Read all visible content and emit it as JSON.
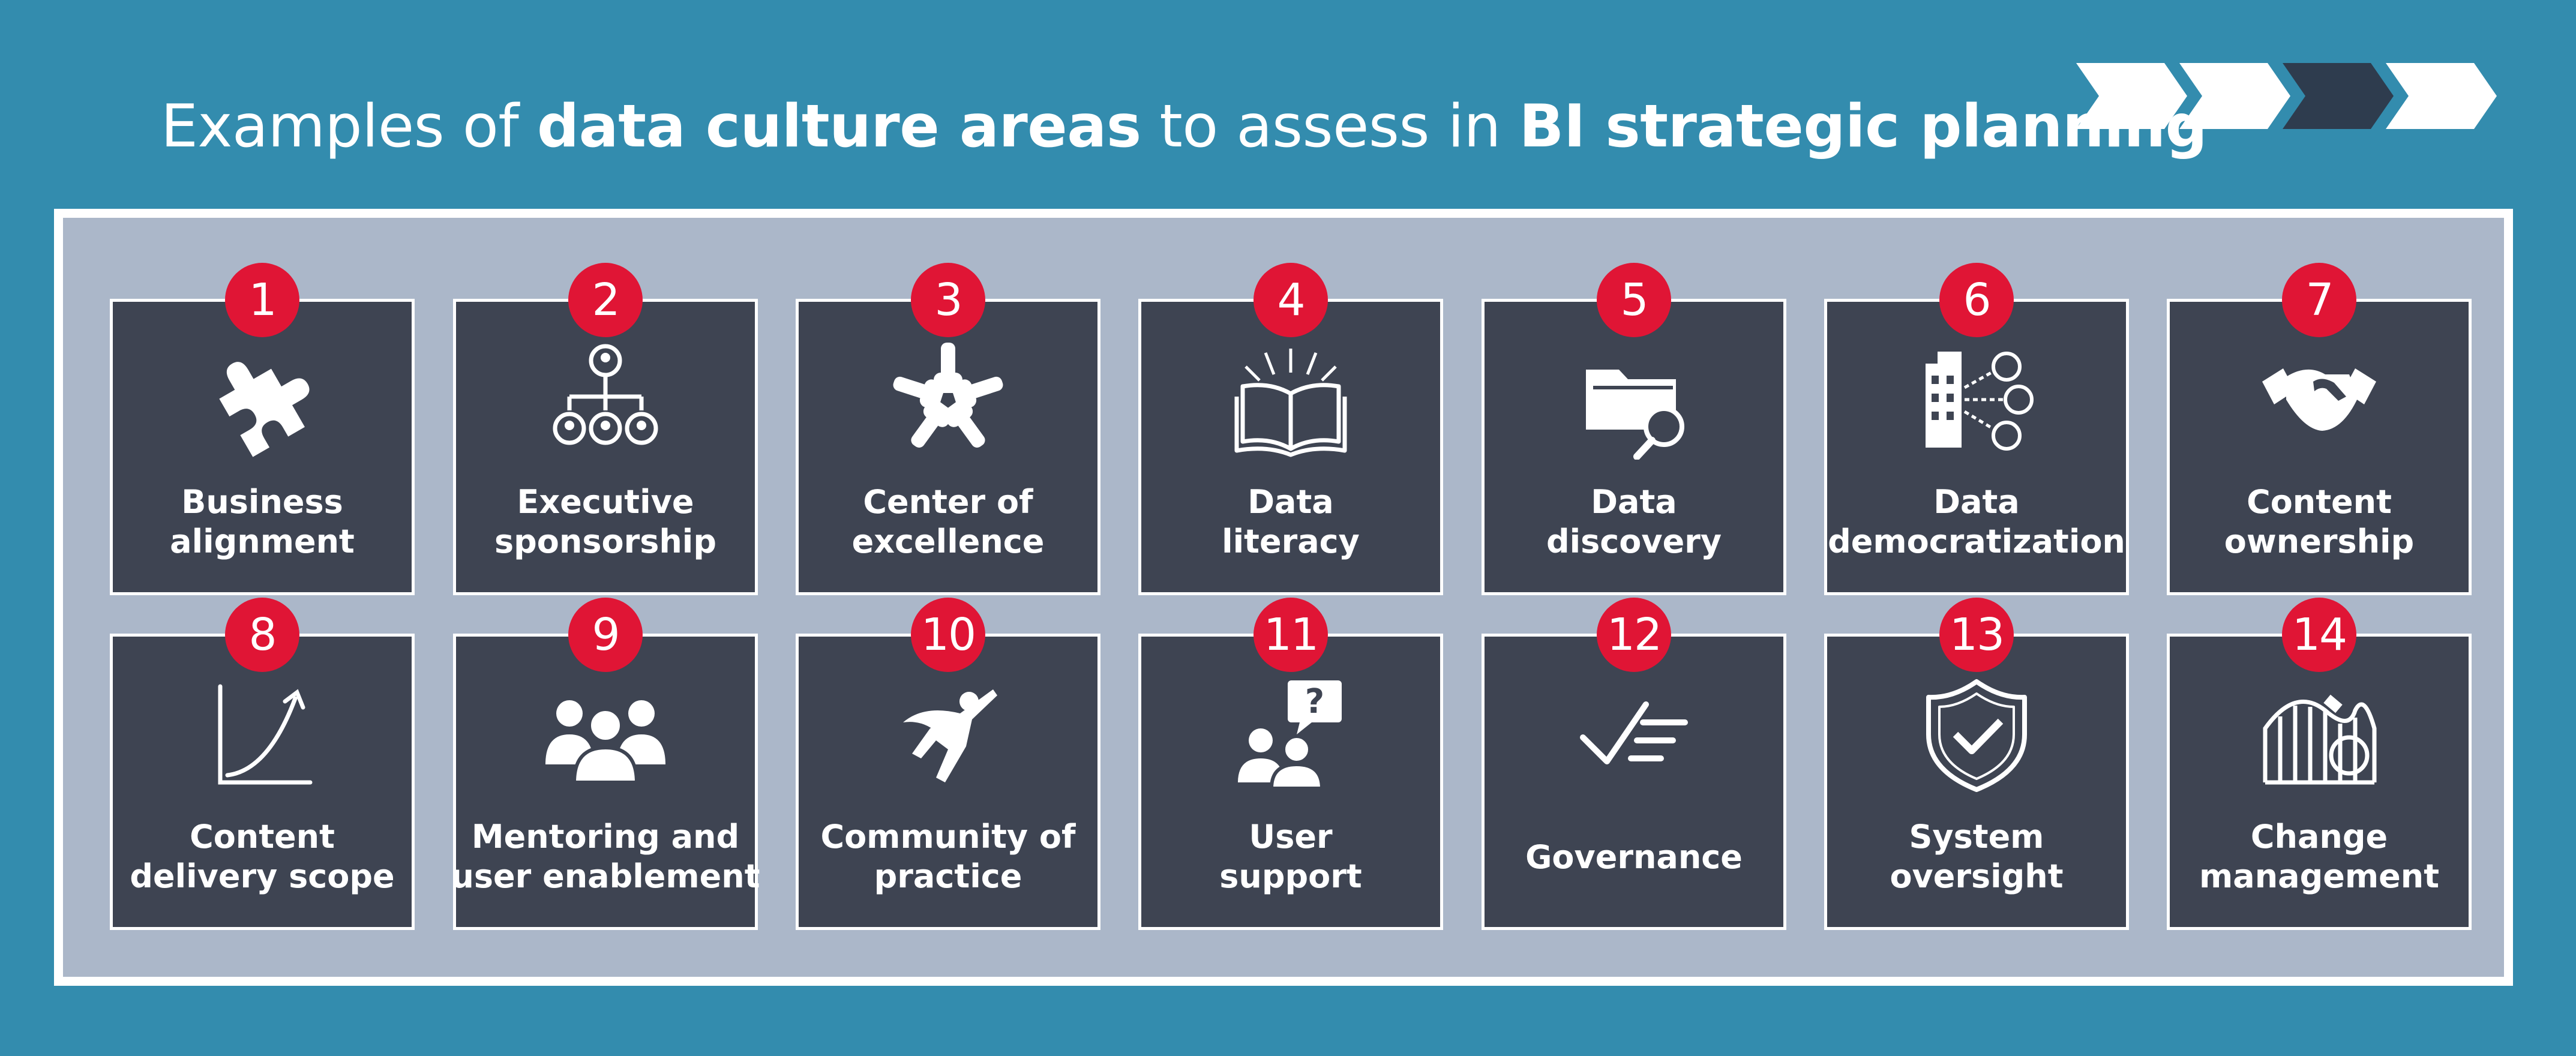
{
  "header": {
    "title_part1": "Examples of ",
    "title_bold1": "data culture areas",
    "title_part2": " to assess in ",
    "title_bold2": "BI strategic planning"
  },
  "progress_chevrons": {
    "count": 4,
    "active_index": 2,
    "active_color": "#2e3c4e",
    "inactive_color": "#ffffff"
  },
  "colors": {
    "background": "#338cae",
    "panel": "#abb7c9",
    "card": "#3e4452",
    "badge": "#e01535"
  },
  "areas": [
    {
      "number": "1",
      "line1": "Business",
      "line2": "alignment",
      "icon": "puzzle-piece-icon"
    },
    {
      "number": "2",
      "line1": "Executive",
      "line2": "sponsorship",
      "icon": "org-chart-icon"
    },
    {
      "number": "3",
      "line1": "Center of",
      "line2": "excellence",
      "icon": "hands-together-icon"
    },
    {
      "number": "4",
      "line1": "Data",
      "line2": "literacy",
      "icon": "open-book-icon"
    },
    {
      "number": "5",
      "line1": "Data",
      "line2": "discovery",
      "icon": "folder-search-icon"
    },
    {
      "number": "6",
      "line1": "Data",
      "line2": "democratization",
      "icon": "building-people-icon"
    },
    {
      "number": "7",
      "line1": "Content",
      "line2": "ownership",
      "icon": "handshake-icon"
    },
    {
      "number": "8",
      "line1": "Content",
      "line2": "delivery scope",
      "icon": "growth-curve-icon"
    },
    {
      "number": "9",
      "line1": "Mentoring and",
      "line2": "user enablement",
      "icon": "people-group-icon"
    },
    {
      "number": "10",
      "line1": "Community of",
      "line2": "practice",
      "icon": "superhero-icon"
    },
    {
      "number": "11",
      "line1": "User",
      "line2": "support",
      "icon": "question-people-icon"
    },
    {
      "number": "12",
      "line1": "Governance",
      "line2": "",
      "icon": "checklist-icon"
    },
    {
      "number": "13",
      "line1": "System",
      "line2": "oversight",
      "icon": "shield-check-icon"
    },
    {
      "number": "14",
      "line1": "Change",
      "line2": "management",
      "icon": "roller-coaster-icon"
    }
  ]
}
